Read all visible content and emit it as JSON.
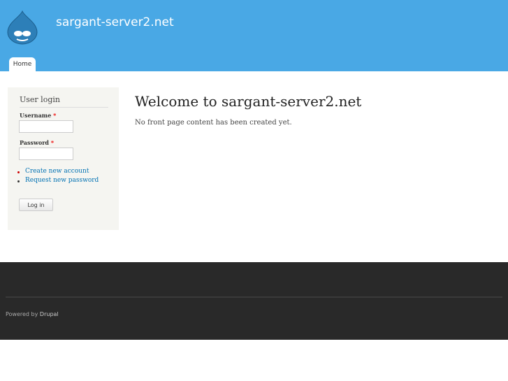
{
  "header": {
    "site_name": "sargant-server2.net",
    "tabs": [
      {
        "label": "Home"
      }
    ]
  },
  "sidebar": {
    "title": "User login",
    "username_label": "Username",
    "password_label": "Password",
    "required": "*",
    "links": [
      "Create new account",
      "Request new password"
    ],
    "login_button": "Log in"
  },
  "main": {
    "title": "Welcome to sargant-server2.net",
    "message": "No front page content has been created yet."
  },
  "footer": {
    "powered_by": "Powered by",
    "drupal": "Drupal"
  }
}
